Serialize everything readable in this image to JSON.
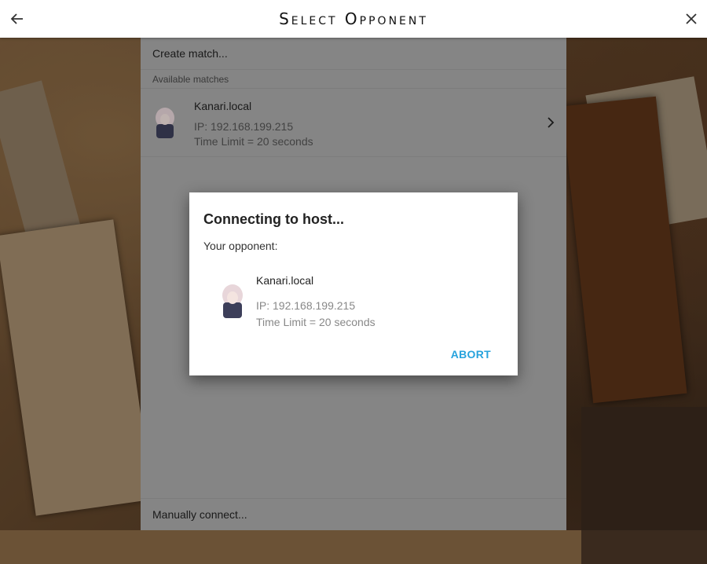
{
  "header": {
    "title": "Select Opponent",
    "back_icon": "arrow-left-icon",
    "close_icon": "close-icon"
  },
  "list": {
    "create_label": "Create match...",
    "available_header": "Available matches",
    "matches": [
      {
        "name": "Kanari.local",
        "ip": "IP: 192.168.199.215",
        "time_limit": "Time Limit = 20 seconds"
      }
    ],
    "manual_label": "Manually connect..."
  },
  "dialog": {
    "title": "Connecting to host...",
    "subtitle": "Your opponent:",
    "opponent": {
      "name": "Kanari.local",
      "ip": "IP: 192.168.199.215",
      "time_limit": "Time Limit = 20 seconds"
    },
    "abort_label": "ABORT"
  },
  "colors": {
    "accent": "#27a3dd",
    "panel": "#ababab",
    "topbar": "#ffffff"
  }
}
